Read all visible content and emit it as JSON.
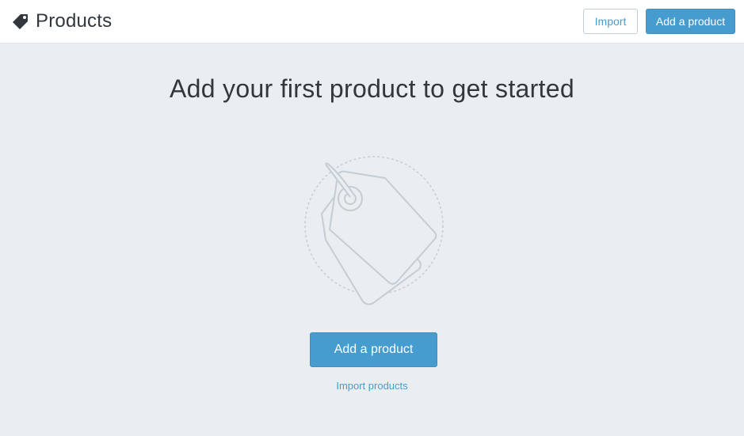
{
  "header": {
    "title": "Products",
    "title_icon": "tag-icon",
    "import_button_label": "Import",
    "add_button_label": "Add a product"
  },
  "empty_state": {
    "heading": "Add your first product to get started",
    "illustration_icon": "product-tags-illustration",
    "primary_button_label": "Add a product",
    "secondary_link_label": "Import products"
  },
  "colors": {
    "accent": "#479ccf",
    "background": "#ebeef0",
    "header_background": "#ffffff",
    "text": "#31373d"
  }
}
